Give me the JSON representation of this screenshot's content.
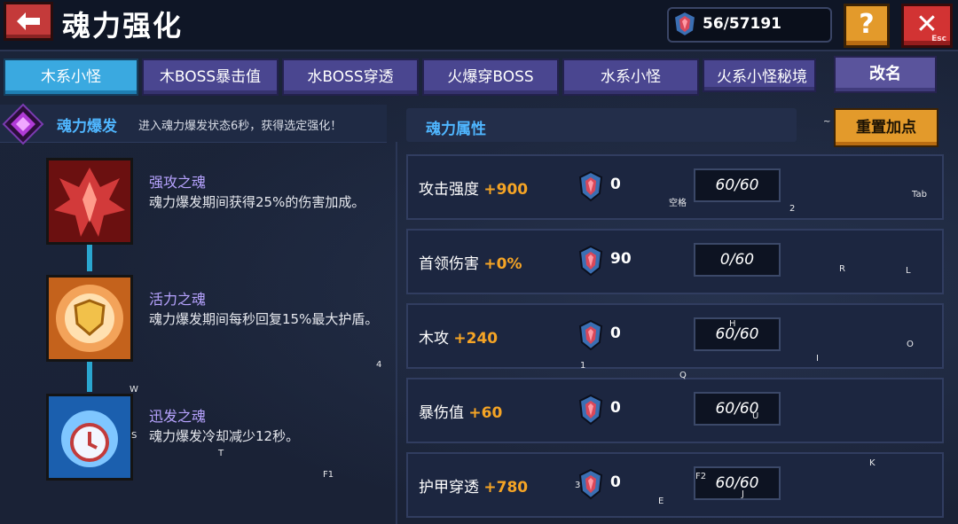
{
  "header": {
    "title": "魂力强化",
    "currency_value": "56/57191",
    "help_label": "?",
    "close_label": "✕",
    "close_hint": "Esc"
  },
  "tabs": [
    {
      "label": "木系小怪",
      "active": true
    },
    {
      "label": "木BOSS暴击值",
      "active": false
    },
    {
      "label": "水BOSS穿透",
      "active": false
    },
    {
      "label": "火爆穿BOSS",
      "active": false
    },
    {
      "label": "水系小怪",
      "active": false
    },
    {
      "label": "火系小怪秘境",
      "active": false
    }
  ],
  "rename_label": "改名",
  "soul_burst": {
    "name": "魂力爆发",
    "desc": "进入魂力爆发状态6秒，获得选定强化！"
  },
  "skills": [
    {
      "name": "强攻之魂",
      "desc": "魂力爆发期间获得25%的伤害加成。",
      "icon": "red-spiky-icon"
    },
    {
      "name": "活力之魂",
      "desc": "魂力爆发期间每秒回复15%最大护盾。",
      "icon": "shield-icon"
    },
    {
      "name": "迅发之魂",
      "desc": "魂力爆发冷却减少12秒。",
      "icon": "clock-icon"
    }
  ],
  "attributes": {
    "title": "魂力属性",
    "reset_label": "重置加点",
    "rows": [
      {
        "name": "攻击强度 ",
        "bonus": "+900",
        "cost": "0",
        "level": "60/60"
      },
      {
        "name": "首领伤害 ",
        "bonus": "+0%",
        "cost": "90",
        "level": "0/60"
      },
      {
        "name": "木攻 ",
        "bonus": "+240",
        "cost": "0",
        "level": "60/60"
      },
      {
        "name": "暴伤值 ",
        "bonus": "+60",
        "cost": "0",
        "level": "60/60"
      },
      {
        "name": "护甲穿透 ",
        "bonus": "+780",
        "cost": "0",
        "level": "60/60"
      }
    ]
  },
  "key_hints": {
    "space": "空格",
    "two": "2",
    "tab": "Tab",
    "r": "R",
    "l": "L",
    "h": "H",
    "o": "O",
    "i": "I",
    "one": "1",
    "q": "Q",
    "four": "4",
    "w": "W",
    "s": "S",
    "u": "U",
    "t": "T",
    "f1": "F1",
    "k": "K",
    "three": "3",
    "f2": "F2",
    "e": "E",
    "j": "J",
    "tilde": "~"
  },
  "colors": {
    "accent_blue": "#4fb6ff",
    "bonus_orange": "#f5a425",
    "skill_purple": "#b7a3ff"
  }
}
